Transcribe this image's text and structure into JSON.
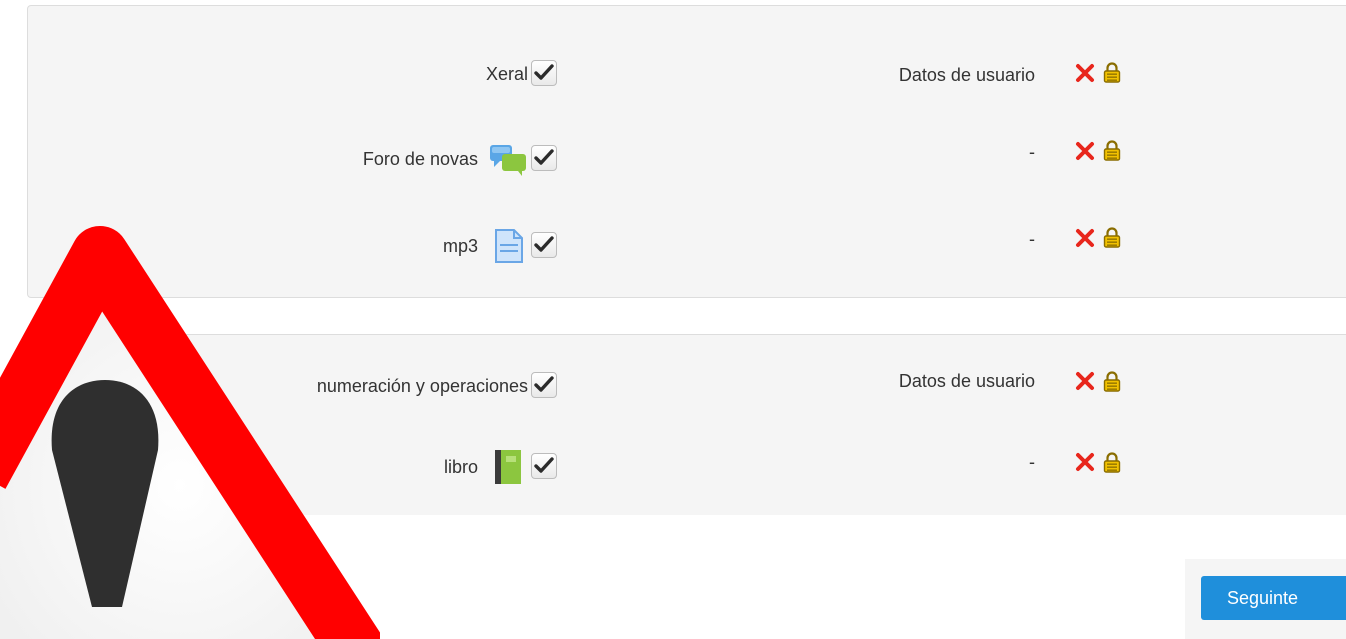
{
  "sections": [
    {
      "rows": [
        {
          "label": "Xeral",
          "icon": "",
          "checked": true,
          "user_data": "Datos de usuario"
        },
        {
          "label": "Foro de novas",
          "icon": "forum-icon",
          "checked": true,
          "user_data": "-"
        },
        {
          "label": "mp3",
          "icon": "file-icon",
          "checked": true,
          "user_data": "-"
        }
      ]
    },
    {
      "rows": [
        {
          "label": "numeración y operaciones",
          "icon": "",
          "checked": true,
          "user_data": "Datos de usuario"
        },
        {
          "label": "libro",
          "icon": "book-icon",
          "checked": true,
          "user_data": "-"
        }
      ]
    }
  ],
  "next_button_label": "Seguinte",
  "colors": {
    "accent": "#1f8fdb",
    "remove": "#e8261c",
    "warning_border": "#ff0000",
    "warning_mark": "#2f2f2f",
    "panel_bg": "#f5f5f5"
  }
}
